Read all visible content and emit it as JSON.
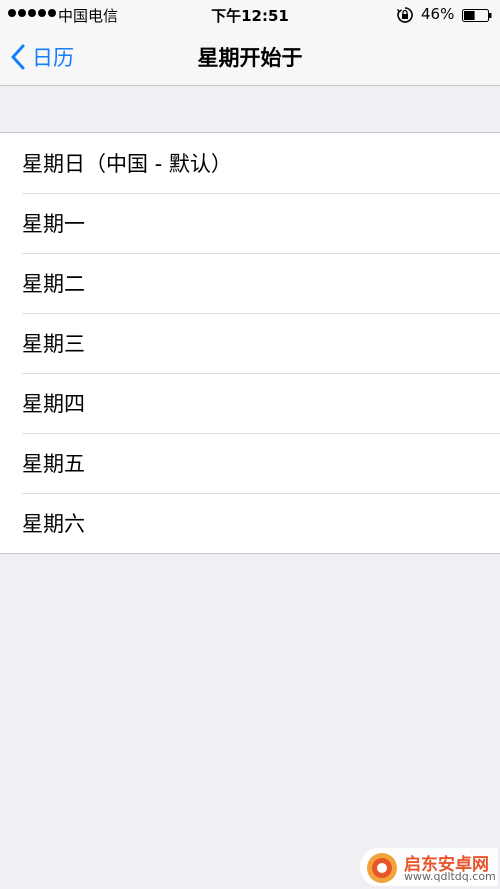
{
  "status_bar": {
    "carrier": "中国电信",
    "time": "下午12:51",
    "battery_percent": "46%",
    "battery_level": 0.46
  },
  "nav": {
    "back_label": "日历",
    "title": "星期开始于"
  },
  "options": [
    {
      "label": "星期日（中国 - 默认）"
    },
    {
      "label": "星期一"
    },
    {
      "label": "星期二"
    },
    {
      "label": "星期三"
    },
    {
      "label": "星期四"
    },
    {
      "label": "星期五"
    },
    {
      "label": "星期六"
    }
  ],
  "watermark": {
    "name": "启东安卓网",
    "url": "www.qdltdq.com"
  },
  "colors": {
    "accent": "#157efb",
    "background": "#efeff4",
    "bar": "#f7f7f8",
    "watermark": "#e8552a"
  },
  "icons": {
    "signal": "signal-dots-icon",
    "orientation_lock": "orientation-lock-icon",
    "battery": "battery-icon",
    "back": "chevron-left-icon"
  }
}
